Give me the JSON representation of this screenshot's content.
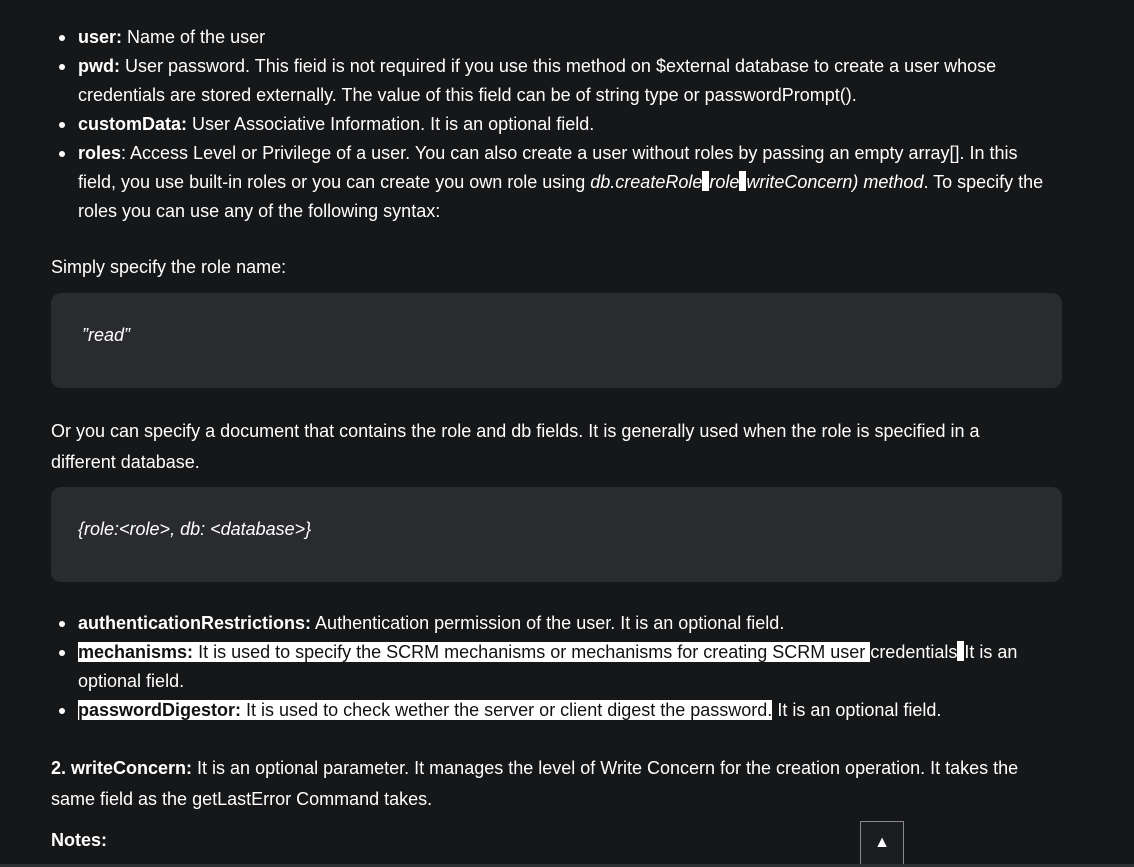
{
  "params_list": [
    {
      "term": "user:",
      "desc": "Name of the user"
    },
    {
      "term": "pwd:",
      "desc": "User password. This fieid is not required if you use this method on $external database to create a user whose credentials are stored externally. The value of this field can be of string type or passwordPrompt()."
    },
    {
      "term": "customData:",
      "desc": "User Associative Information. It is an optional field."
    },
    {
      "term": "roles",
      "desc_a": ": Access Level or Privilege of a user. You can also create a user without roles by passing an empty array[]. In this field, you use built-in roles or you can create you own role using ",
      "code_a": "db.createRole",
      "code_b": "role",
      "code_c": "writeConcern) method",
      "desc_b": ". To specify the roles you can use any of the following syntax:"
    }
  ],
  "simple_role_intro": "Simply specify the role name:",
  "code_simple": "”read”",
  "document_intro": "Or you can specify a document that contains the role and db fields. It is generally used when the role is specified in a different database.",
  "code_document": "{role:<role>, db: <database>}",
  "options_list": [
    {
      "term": "authenticationRestrictions:",
      "desc": "Authentication permission of the user. It is an optional field."
    },
    {
      "term": "mechanisms:",
      "desc_highlighted": "It is used to specify the SCRM mechanisms or mechanisms for creating SCRM user ",
      "desc_plain": "credentials",
      "desc_rest": "It is an optional field."
    },
    {
      "term": "passwordDigestor:",
      "desc_highlighted": "It is used to check wether the server or client digest the password.",
      "desc_rest": "It is an optional field."
    }
  ],
  "write_concern": {
    "term": "2. writeConcern:",
    "desc": "It is an optional parameter. It manages the level of Write Concern for the creation operation. It takes the same field as the getLastError Command takes."
  },
  "notes_heading": "Notes:",
  "scroll_top_icon": "▲",
  "icons": {
    "scroll_top": "arrow-up-icon"
  }
}
